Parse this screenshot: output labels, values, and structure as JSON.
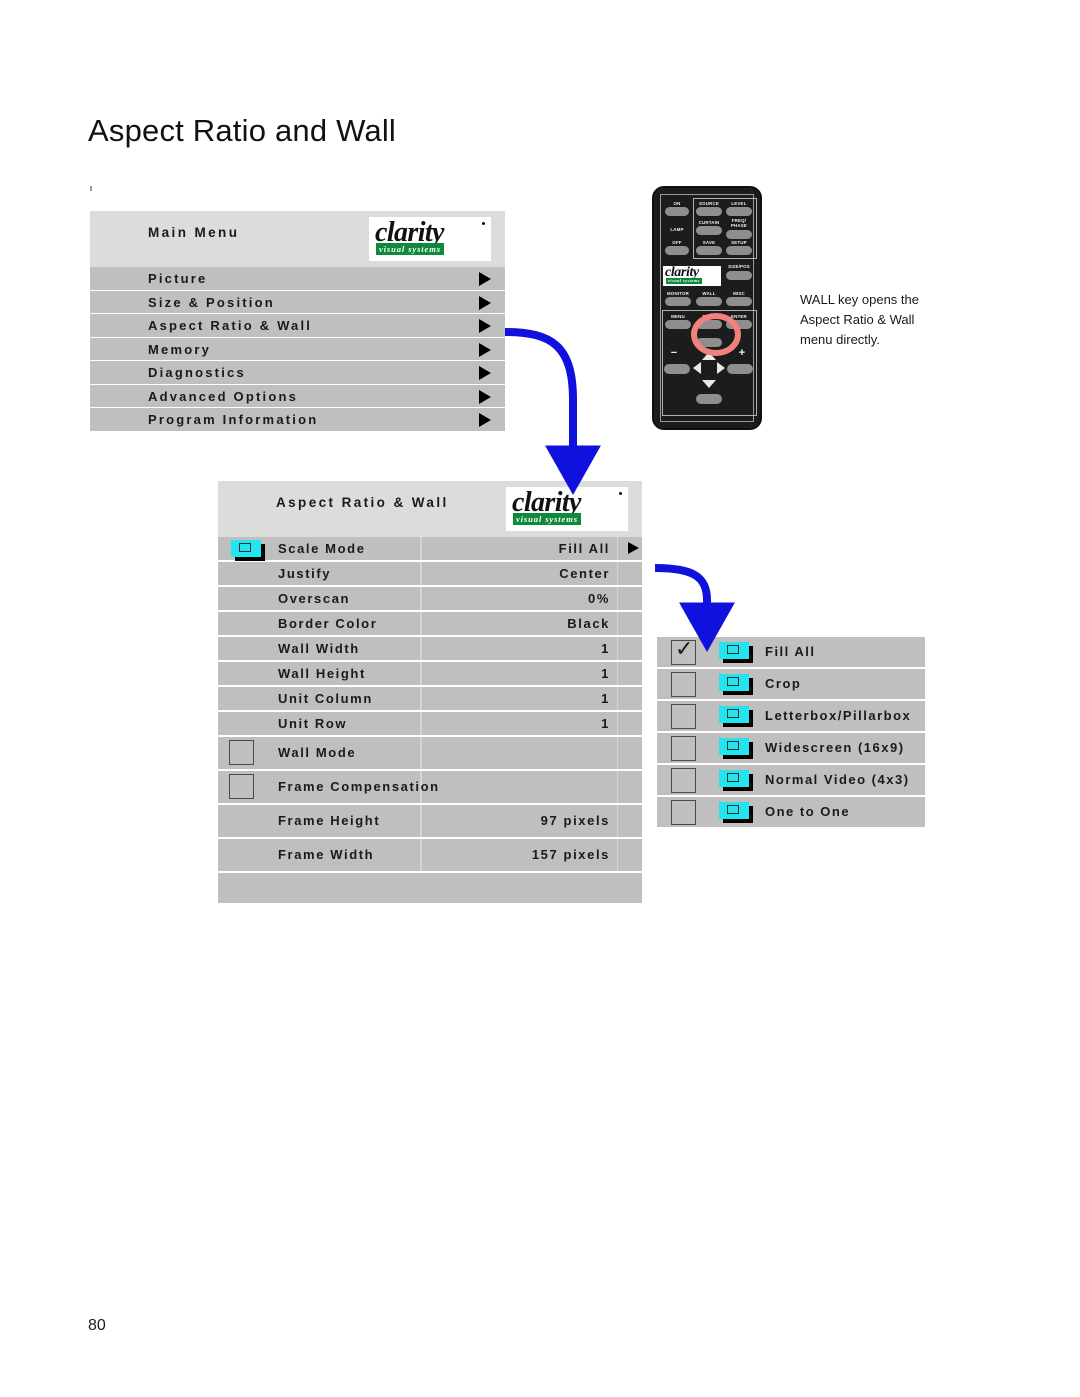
{
  "page": {
    "title": "Aspect Ratio and Wall",
    "number": "80"
  },
  "brand": {
    "logo_word": "clarity",
    "logo_sub": "visual systems"
  },
  "colors": {
    "panel_bg": "#bfbfbf",
    "panel_header_bg": "#dcdcdc",
    "icon_cyan": "#22e5ef",
    "logo_green": "#0f8a3c",
    "arrow_blue": "#1111dd",
    "highlight_red": "#f2807c"
  },
  "main_menu": {
    "title": "Main Menu",
    "items": [
      {
        "label": "Picture",
        "arrow": "triangle-right-icon"
      },
      {
        "label": "Size & Position",
        "arrow": "triangle-right-icon"
      },
      {
        "label": "Aspect Ratio & Wall",
        "arrow": "triangle-right-icon"
      },
      {
        "label": "Memory",
        "arrow": "triangle-right-icon"
      },
      {
        "label": "Diagnostics",
        "arrow": "triangle-right-icon"
      },
      {
        "label": "Advanced Options",
        "arrow": "triangle-right-icon"
      },
      {
        "label": "Program Information",
        "arrow": "triangle-right-icon"
      }
    ]
  },
  "aspect_menu": {
    "title": "Aspect Ratio & Wall",
    "rows": [
      {
        "label": "Scale Mode",
        "value": "Fill All",
        "icon": "screen-icon",
        "arrow": true,
        "tall": false
      },
      {
        "label": "Justify",
        "value": "Center",
        "icon": "",
        "arrow": false,
        "tall": false
      },
      {
        "label": "Overscan",
        "value": "0%",
        "icon": "",
        "arrow": false,
        "tall": false
      },
      {
        "label": "Border Color",
        "value": "Black",
        "icon": "",
        "arrow": false,
        "tall": false
      },
      {
        "label": "Wall Width",
        "value": "1",
        "icon": "",
        "arrow": false,
        "tall": false
      },
      {
        "label": "Wall Height",
        "value": "1",
        "icon": "",
        "arrow": false,
        "tall": false
      },
      {
        "label": "Unit Column",
        "value": "1",
        "icon": "",
        "arrow": false,
        "tall": false
      },
      {
        "label": "Unit Row",
        "value": "1",
        "icon": "",
        "arrow": false,
        "tall": false
      },
      {
        "label": "Wall Mode",
        "value": "",
        "icon": "empty-square-icon",
        "arrow": false,
        "tall": true
      },
      {
        "label": "Frame Compensation",
        "value": "",
        "icon": "empty-square-icon",
        "arrow": false,
        "tall": true
      },
      {
        "label": "Frame Height",
        "value": "97 pixels",
        "icon": "",
        "arrow": false,
        "tall": true
      },
      {
        "label": "Frame Width",
        "value": "157 pixels",
        "icon": "",
        "arrow": false,
        "tall": true
      }
    ]
  },
  "scale_mode_options": {
    "items": [
      {
        "label": "Fill All",
        "checked": true,
        "icon": "screen-icon",
        "check_glyph": "✓"
      },
      {
        "label": "Crop",
        "checked": false,
        "icon": "screen-icon",
        "check_glyph": ""
      },
      {
        "label": "Letterbox/Pillarbox",
        "checked": false,
        "icon": "screen-icon",
        "check_glyph": ""
      },
      {
        "label": "Widescreen (16x9)",
        "checked": false,
        "icon": "screen-icon",
        "check_glyph": ""
      },
      {
        "label": "Normal Video (4x3)",
        "checked": false,
        "icon": "screen-icon",
        "check_glyph": ""
      },
      {
        "label": "One to One",
        "checked": false,
        "icon": "screen-icon",
        "check_glyph": ""
      }
    ]
  },
  "remote": {
    "buttons": [
      {
        "label": "ON"
      },
      {
        "label": "SOURCE"
      },
      {
        "label": "LEVEL"
      },
      {
        "label": "LAMP"
      },
      {
        "label": "CURTAIN"
      },
      {
        "label": "FREQ/\nPHASE"
      },
      {
        "label": "OFF"
      },
      {
        "label": "SAVE"
      },
      {
        "label": "SETUP"
      },
      {
        "label": "SIZE/POS"
      },
      {
        "label": "MONITOR"
      },
      {
        "label": "WALL"
      },
      {
        "label": "MISC"
      },
      {
        "label": "MENU"
      },
      {
        "label": "PREV"
      },
      {
        "label": "ENTER"
      },
      {
        "label": "−"
      },
      {
        "label": "+"
      }
    ],
    "highlighted_button": "PREV"
  },
  "caption": {
    "text": "WALL key opens the Aspect Ratio & Wall menu directly."
  }
}
